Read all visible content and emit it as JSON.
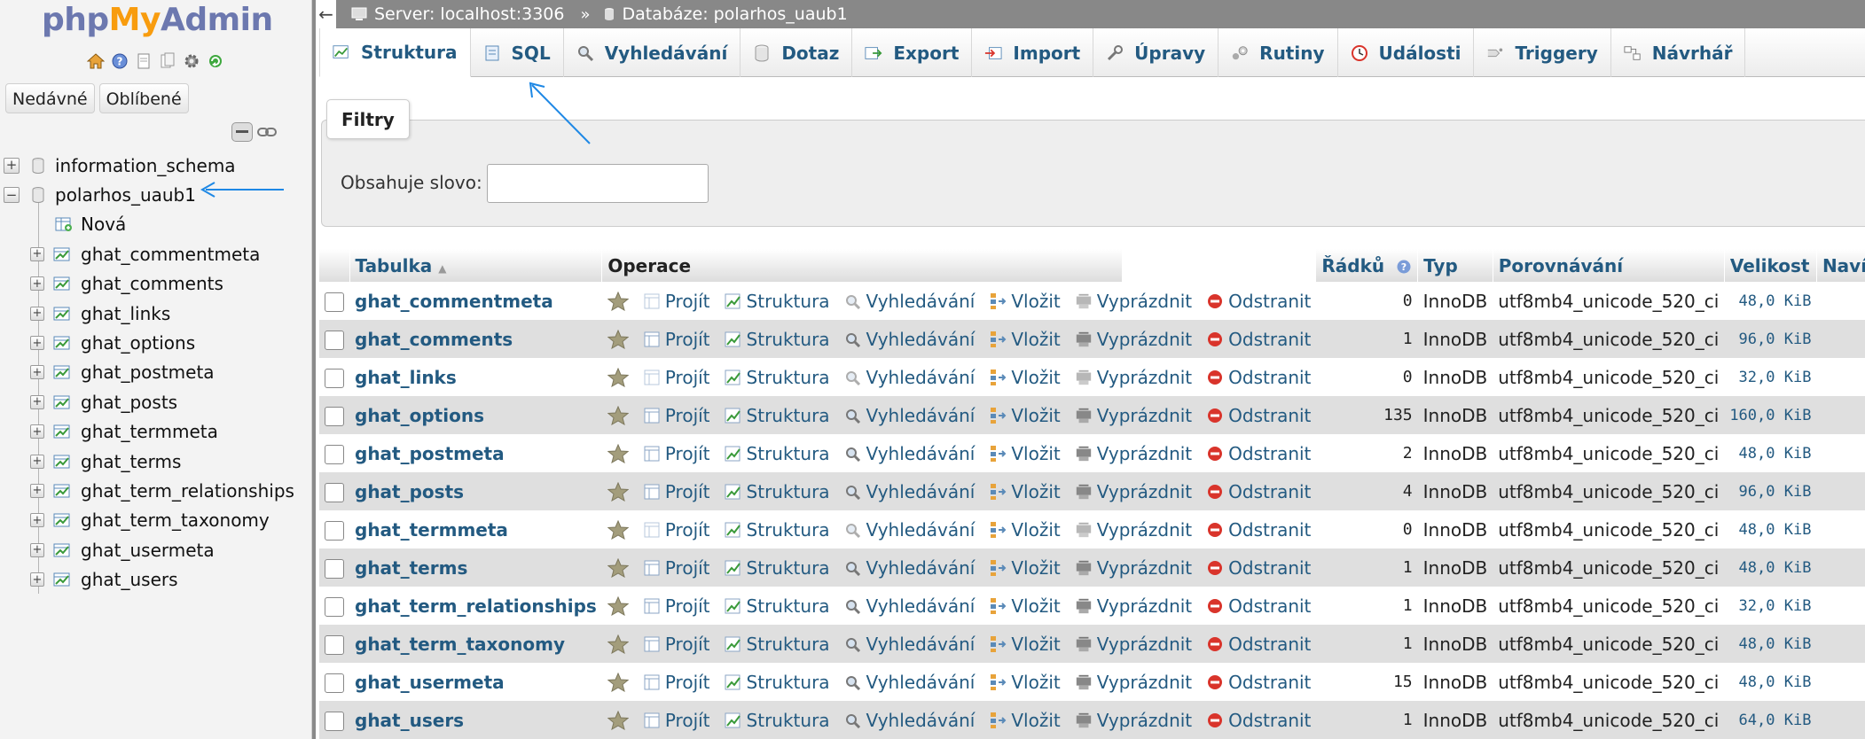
{
  "logo": {
    "php": "php",
    "my": "My",
    "admin": "Admin"
  },
  "sidebar": {
    "quick_icons": [
      "home-icon",
      "help-icon",
      "docs-icon",
      "copy-icon",
      "settings-icon",
      "reload-icon"
    ],
    "recent_label": "Nedávné",
    "favorites_label": "Oblíbené",
    "tree": {
      "databases": [
        {
          "label": "information_schema",
          "expanded": false
        },
        {
          "label": "polarhos_uaub1",
          "expanded": true
        }
      ],
      "new_label": "Nová",
      "tables": [
        "ghat_commentmeta",
        "ghat_comments",
        "ghat_links",
        "ghat_options",
        "ghat_postmeta",
        "ghat_posts",
        "ghat_termmeta",
        "ghat_terms",
        "ghat_term_relationships",
        "ghat_term_taxonomy",
        "ghat_usermeta",
        "ghat_users"
      ]
    }
  },
  "breadcrumb": {
    "server": "Server: localhost:3306",
    "database": "Databáze: polarhos_uaub1",
    "sep": "»"
  },
  "tabs": [
    {
      "label": "Struktura",
      "icon": "structure-icon"
    },
    {
      "label": "SQL",
      "icon": "sql-icon"
    },
    {
      "label": "Vyhledávání",
      "icon": "search-icon"
    },
    {
      "label": "Dotaz",
      "icon": "query-icon"
    },
    {
      "label": "Export",
      "icon": "export-icon"
    },
    {
      "label": "Import",
      "icon": "import-icon"
    },
    {
      "label": "Úpravy",
      "icon": "wrench-icon"
    },
    {
      "label": "Rutiny",
      "icon": "routines-icon"
    },
    {
      "label": "Události",
      "icon": "events-icon"
    },
    {
      "label": "Triggery",
      "icon": "triggers-icon"
    },
    {
      "label": "Návrhář",
      "icon": "designer-icon"
    }
  ],
  "filters": {
    "title": "Filtry",
    "label": "Obsahuje slovo:",
    "value": ""
  },
  "table": {
    "headers": {
      "table": "Tabulka",
      "sort": "▲",
      "operations": "Operace",
      "rows": "Řádků",
      "type": "Typ",
      "collation": "Porovnávání",
      "size": "Velikost",
      "overhead": "Navíc"
    },
    "actions": {
      "browse": "Projít",
      "structure": "Struktura",
      "search": "Vyhledávání",
      "insert": "Vložit",
      "empty": "Vyprázdnit",
      "drop": "Odstranit"
    },
    "rows": [
      {
        "name": "ghat_commentmeta",
        "rows": "0",
        "type": "InnoDB",
        "collation": "utf8mb4_unicode_520_ci",
        "size": "48,0 KiB",
        "overhead": "-"
      },
      {
        "name": "ghat_comments",
        "rows": "1",
        "type": "InnoDB",
        "collation": "utf8mb4_unicode_520_ci",
        "size": "96,0 KiB",
        "overhead": "-"
      },
      {
        "name": "ghat_links",
        "rows": "0",
        "type": "InnoDB",
        "collation": "utf8mb4_unicode_520_ci",
        "size": "32,0 KiB",
        "overhead": "-"
      },
      {
        "name": "ghat_options",
        "rows": "135",
        "type": "InnoDB",
        "collation": "utf8mb4_unicode_520_ci",
        "size": "160,0 KiB",
        "overhead": "-"
      },
      {
        "name": "ghat_postmeta",
        "rows": "2",
        "type": "InnoDB",
        "collation": "utf8mb4_unicode_520_ci",
        "size": "48,0 KiB",
        "overhead": "-"
      },
      {
        "name": "ghat_posts",
        "rows": "4",
        "type": "InnoDB",
        "collation": "utf8mb4_unicode_520_ci",
        "size": "96,0 KiB",
        "overhead": "-"
      },
      {
        "name": "ghat_termmeta",
        "rows": "0",
        "type": "InnoDB",
        "collation": "utf8mb4_unicode_520_ci",
        "size": "48,0 KiB",
        "overhead": "-"
      },
      {
        "name": "ghat_terms",
        "rows": "1",
        "type": "InnoDB",
        "collation": "utf8mb4_unicode_520_ci",
        "size": "48,0 KiB",
        "overhead": "-"
      },
      {
        "name": "ghat_term_relationships",
        "rows": "1",
        "type": "InnoDB",
        "collation": "utf8mb4_unicode_520_ci",
        "size": "32,0 KiB",
        "overhead": "-"
      },
      {
        "name": "ghat_term_taxonomy",
        "rows": "1",
        "type": "InnoDB",
        "collation": "utf8mb4_unicode_520_ci",
        "size": "48,0 KiB",
        "overhead": "-"
      },
      {
        "name": "ghat_usermeta",
        "rows": "15",
        "type": "InnoDB",
        "collation": "utf8mb4_unicode_520_ci",
        "size": "48,0 KiB",
        "overhead": "-"
      },
      {
        "name": "ghat_users",
        "rows": "1",
        "type": "InnoDB",
        "collation": "utf8mb4_unicode_520_ci",
        "size": "64,0 KiB",
        "overhead": "-"
      }
    ]
  },
  "colors": {
    "link": "#235a81",
    "arrow": "#1e88e5",
    "drop": "#d9342b",
    "star": "#a09a7a"
  }
}
